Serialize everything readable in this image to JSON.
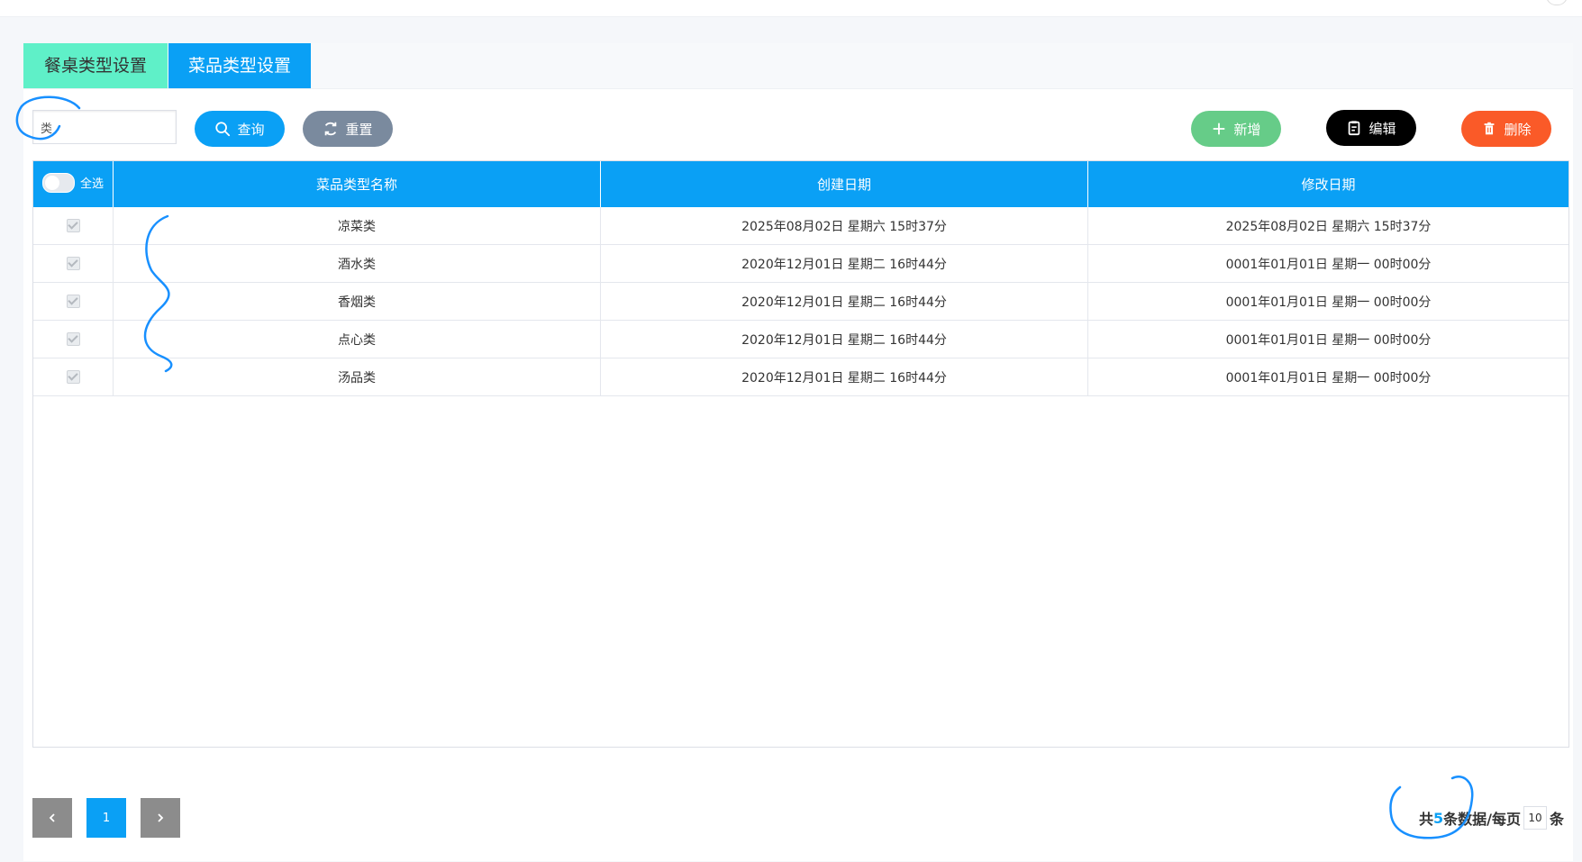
{
  "tabs": [
    {
      "label": "餐桌类型设置"
    },
    {
      "label": "菜品类型设置"
    }
  ],
  "search": {
    "value": "类"
  },
  "toolbar": {
    "query_label": "查询",
    "reset_label": "重置",
    "add_label": "新增",
    "edit_label": "编辑",
    "delete_label": "删除"
  },
  "table": {
    "select_all_label": "全选",
    "columns": [
      "菜品类型名称",
      "创建日期",
      "修改日期"
    ],
    "rows": [
      {
        "name": "凉菜类",
        "created": "2025年08月02日 星期六 15时37分",
        "modified": "2025年08月02日 星期六 15时37分"
      },
      {
        "name": "酒水类",
        "created": "2020年12月01日 星期二 16时44分",
        "modified": "0001年01月01日 星期一 00时00分"
      },
      {
        "name": "香烟类",
        "created": "2020年12月01日 星期二 16时44分",
        "modified": "0001年01月01日 星期一 00时00分"
      },
      {
        "name": "点心类",
        "created": "2020年12月01日 星期二 16时44分",
        "modified": "0001年01月01日 星期一 00时00分"
      },
      {
        "name": "汤品类",
        "created": "2020年12月01日 星期二 16时44分",
        "modified": "0001年01月01日 星期一 00时00分"
      }
    ]
  },
  "pagination": {
    "prev_icon": "chevron-left-icon",
    "current_page": "1",
    "next_icon": "chevron-right-icon",
    "summary_prefix": "共",
    "total": "5",
    "summary_mid": "条数据/每页",
    "page_size": "10",
    "summary_suffix": "条"
  },
  "colors": {
    "primary": "#0aa0f5",
    "tab_inactive": "#5ff0c8",
    "reset": "#7a8a9e",
    "add": "#66cc88",
    "edit": "#000000",
    "delete": "#fa5a28",
    "annotation": "#1890ff"
  }
}
